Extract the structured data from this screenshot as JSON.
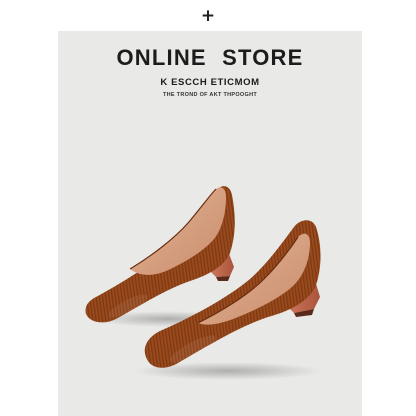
{
  "header": {
    "expand_symbol": "+"
  },
  "banner": {
    "title": "ONLINE  STORE",
    "subtitle": "K ESCCH ETICMOM",
    "tagline": "THE TROND OF AKT THPOOGHT"
  },
  "colors": {
    "background": "#e9e9e7",
    "shoe_knit": "#9a4a1c",
    "shoe_lining": "#d9a98a",
    "heel": "#c66c52"
  },
  "product": {
    "icon": "shoe-pair-image"
  }
}
